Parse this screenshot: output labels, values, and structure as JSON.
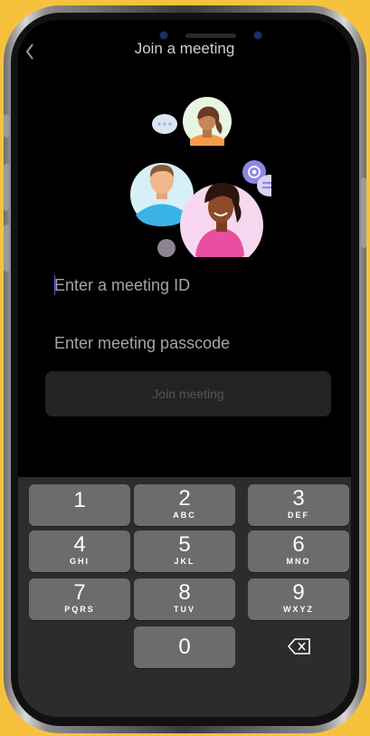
{
  "header": {
    "title": "Join a meeting",
    "back_icon": "chevron-left-icon"
  },
  "form": {
    "meeting_id_placeholder": "Enter a meeting ID",
    "meeting_id_value": "",
    "passcode_placeholder": "Enter meeting passcode",
    "passcode_value": "",
    "join_label": "Join meeting"
  },
  "keypad": {
    "keys": [
      {
        "num": "1",
        "letters": ""
      },
      {
        "num": "2",
        "letters": "ABC"
      },
      {
        "num": "3",
        "letters": "DEF"
      },
      {
        "num": "4",
        "letters": "GHI"
      },
      {
        "num": "5",
        "letters": "JKL"
      },
      {
        "num": "6",
        "letters": "MNO"
      },
      {
        "num": "7",
        "letters": "PQRS"
      },
      {
        "num": "8",
        "letters": "TUV"
      },
      {
        "num": "9",
        "letters": "WXYZ"
      },
      {
        "num": "0",
        "letters": ""
      }
    ],
    "delete_icon": "backspace-icon"
  },
  "colors": {
    "background": "#000000",
    "keypad_bg": "#2c2c2c",
    "key_bg": "#6c6c6c",
    "frame": "#f6c23e",
    "accent": "#6b5bd6"
  }
}
